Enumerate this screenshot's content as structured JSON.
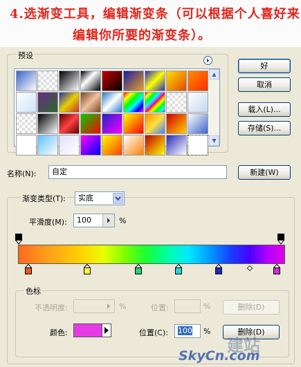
{
  "caption": {
    "line1": "4.选渐变工具，编辑渐变条（可以根据个人喜好来",
    "line2": "编辑你所要的渐变条）。"
  },
  "presets": {
    "label": "预设",
    "menu_icon": "circle-arrow-right-icon",
    "tiles": [
      "linear-gradient(135deg,#3a63c5,#ffffff)",
      "repeating-conic-gradient(#ddd 0 25%,#fff 0 50%) 0 0/8px 8px",
      "linear-gradient(135deg,#000,#fff)",
      "linear-gradient(135deg,#000,#fff 40%,#000)",
      "linear-gradient(135deg,#c70000,#000)",
      "linear-gradient(135deg,#1a1aa8,#e8a020)",
      "linear-gradient(135deg,#2b2bc8,#ffff00,#2b2bc8)",
      "linear-gradient(135deg,#ffde00,#e04a00)",
      "linear-gradient(135deg,#ff8c00,#ff2e00)",
      "linear-gradient(135deg,#ffffff,#cde0ff)",
      "linear-gradient(135deg,#6a2a8a,#2a6a2a)",
      "linear-gradient(135deg,#2a2ab8,#e6d000,#c83030)",
      "linear-gradient(135deg,#7a4a20,#f0c0a0,#7a4a20)",
      "linear-gradient(135deg,#2a7ac8,#ffffff,#2a7ac8)",
      "linear-gradient(135deg,#ff0000,#ffff00,#00ff00,#00ffff,#0000ff,#ff00ff)",
      "repeating-linear-gradient(135deg,#ff0000 0,#ffff00 5px,#00ff00 10px,#00ffff 15px,#ff00ff 20px)",
      "repeating-conic-gradient(#ddd 0 25%,#fff 0 50%) 0 0/8px 8px",
      "linear-gradient(135deg,#ffffff,#c4d6f0)",
      "repeating-conic-gradient(#ddd 0 25%,#fff 0 50%) 0 0/8px 8px",
      "linear-gradient(135deg,#000,#fff)",
      "linear-gradient(135deg,#600000,#ff4040,#600000)",
      "linear-gradient(135deg,#00d000,#ff0000)",
      "linear-gradient(135deg,#2020d0,#ff00ff)",
      "linear-gradient(135deg,#ffff00,#ff0000)",
      "linear-gradient(135deg,#ff8c00,#ffe040,#4080ff)",
      "linear-gradient(135deg,#d00000,#ffd000)",
      "linear-gradient(135deg,#ffffff,#3c64c8)",
      "linear-gradient(135deg,#ffffff,#ffffff)",
      "linear-gradient(135deg,#60c0ff,#ffffff)",
      "linear-gradient(135deg,#e0e0ff,#ffffff)",
      "linear-gradient(135deg,#ff00ff,#0000ff)",
      "linear-gradient(135deg,#ffff00,#ff4000)",
      "linear-gradient(135deg,#ffffff,#ff8000)",
      "linear-gradient(135deg,#c00000,#ffff00)",
      "linear-gradient(135deg,#2a2ab8,#ffffff)",
      "linear-gradient(135deg,#ffffff,#ffffff)"
    ]
  },
  "buttons": {
    "ok": "好",
    "cancel": "取消",
    "load": "载入(L)...",
    "save": "存储(S)...",
    "new": "新建(W)"
  },
  "name": {
    "label": "名称(N):",
    "value": "自定"
  },
  "gradient": {
    "type_label": "渐变类型(T):",
    "type_value": "实底",
    "smoothness_label": "平滑度(M):",
    "smoothness_value": "100",
    "smoothness_unit": "%",
    "bar_gradient": "linear-gradient(to right,#ff6a1c 0%,#ff9a1c 10%,#ffd400 24%,#e9ff00 32%,#7cff00 40%,#16ff33 48%,#00ffa6 56%,#00e8ff 64%,#0099ff 72%,#1a3cff 80%,#4a00ff 87%,#b700ff 94%,#e000e0 100%)",
    "color_stops": [
      {
        "position": 0.04,
        "color": "#e8581c"
      },
      {
        "position": 0.26,
        "color": "#ffff40"
      },
      {
        "position": 0.45,
        "color": "#28d07a"
      },
      {
        "position": 0.6,
        "color": "#28d8d8"
      },
      {
        "position": 0.75,
        "color": "#1830b8"
      },
      {
        "position": 0.97,
        "color": "#d030d0"
      }
    ],
    "opacity_stops": [
      {
        "position": 0.0
      },
      {
        "position": 1.0
      }
    ]
  },
  "stops": {
    "label": "色标",
    "opacity_label": "不透明度:",
    "opacity_unit": "%",
    "opacity_position_label": "位置:",
    "opacity_position_unit": "%",
    "opacity_delete": "删除(D)",
    "color_label": "颜色:",
    "color_value": "#e53be5",
    "color_position_label": "位置(C):",
    "color_position_value": "100",
    "color_position_unit": "%",
    "color_delete": "删除(D)"
  },
  "watermark": {
    "text_cn": "建站",
    "text_en": "SkyCn.com"
  }
}
